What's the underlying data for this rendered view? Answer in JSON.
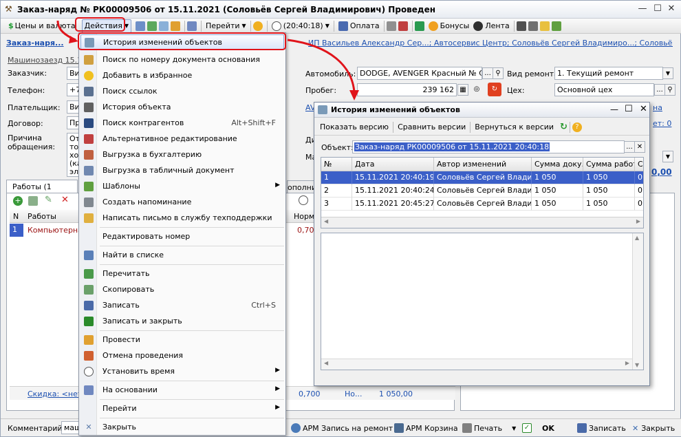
{
  "window": {
    "title": "Заказ-наряд № РК00009506 от 15.11.2021 (Соловьёв Сергей Владимирович) Проведен"
  },
  "toolbar": {
    "prices_currency": "Цены и валюта",
    "actions": "Действия",
    "go": "Перейти",
    "time": "(20:40:18)",
    "payment": "Оплата",
    "bonuses": "Бонусы",
    "tape": "Лента"
  },
  "form": {
    "tab_label": "Заказ-наря...",
    "header_link": "Машинозаезд 15.11",
    "org_link": "ИП Васильев Александр Сер...; Автосервис Центр; Соловьёв Сергей Владимиро...; Соловьёв Серге...",
    "customer_label": "Заказчик:",
    "customer_value": "Ви",
    "phone_label": "Телефон:",
    "phone_value": "+7",
    "payer_label": "Плательщик:",
    "payer_value": "Ви",
    "contract_label": "Договор:",
    "contract_value": "Пр",
    "reason_label": "Причина обращения:",
    "reason_lines": [
      "От",
      "тор",
      "хол",
      "(ка",
      "эл"
    ],
    "car_label": "Автомобиль:",
    "car_value": "DODGE, AVENGER Красный № С3",
    "mileage_label": "Пробег:",
    "mileage_value": "239 162",
    "repair_type_label": "Вид ремонта:",
    "repair_type_value": "1. Текущий ремонт",
    "shop_label": "Цех:",
    "shop_value": "Основной цех",
    "av_link": "AV",
    "di_label": "Ди",
    "ma_label": "Ма",
    "right_link_1": "на",
    "right_link_2": "ет: 0",
    "right_link_3": "0,00",
    "works_tab": "Работы (1 поз.)",
    "extra_tab": "ополнит",
    "col_n": "N",
    "col_works": "Работы",
    "col_norm": "Норм.",
    "row_n": "1",
    "row_work": "Компьютерная",
    "row_norm": "0,70",
    "discount": "Скидка: <нет>",
    "sum_norm": "0,700",
    "sum_no": "Но...",
    "sum_total": "1 050,00",
    "comment_label": "Комментарий:",
    "comment_value": "маш"
  },
  "menu": {
    "items": [
      {
        "label": "История изменений объектов"
      },
      {
        "label": "Поиск по номеру документа основания"
      },
      {
        "label": "Добавить в избранное"
      },
      {
        "label": "Поиск ссылок"
      },
      {
        "label": "История объекта"
      },
      {
        "label": "Поиск контрагентов",
        "shortcut": "Alt+Shift+F"
      },
      {
        "label": "Альтернативное редактирование"
      },
      {
        "label": "Выгрузка в бухгалтерию"
      },
      {
        "label": "Выгрузка в табличный документ"
      },
      {
        "label": "Шаблоны"
      },
      {
        "label": "Создать напоминание"
      },
      {
        "label": "Написать письмо в службу техподдержки"
      },
      {
        "label": "Редактировать номер"
      },
      {
        "label": "Найти в списке"
      },
      {
        "label": "Перечитать"
      },
      {
        "label": "Скопировать"
      },
      {
        "label": "Записать",
        "shortcut": "Ctrl+S"
      },
      {
        "label": "Записать и закрыть"
      },
      {
        "label": "Провести"
      },
      {
        "label": "Отмена проведения"
      },
      {
        "label": "Установить время"
      },
      {
        "label": "На основании"
      },
      {
        "label": "Перейти"
      },
      {
        "label": "Закрыть"
      }
    ]
  },
  "dialog": {
    "title": "История изменений объектов",
    "show_version": "Показать версию",
    "compare": "Сравнить версии",
    "revert": "Вернуться к версии",
    "object_label": "Объект:",
    "object_value": "Заказ-наряд РК00009506 от 15.11.2021 20:40:18",
    "columns": [
      "№",
      "Дата",
      "Автор изменений",
      "Сумма доку...",
      "Сумма работ",
      "С"
    ],
    "rows": [
      [
        "1",
        "15.11.2021 20:40:19",
        "Соловьёв Сергей Влади...",
        "1 050",
        "1 050",
        "0"
      ],
      [
        "2",
        "15.11.2021 20:40:24",
        "Соловьёв Сергей Влади...",
        "1 050",
        "1 050",
        "0"
      ],
      [
        "3",
        "15.11.2021 20:45:27",
        "Соловьёв Сергей Влади...",
        "1 050",
        "1 050",
        "0"
      ]
    ]
  },
  "bottom": {
    "arm_repair": "АРМ Запись на ремонт",
    "arm_cart": "АРМ Корзина",
    "print": "Печать",
    "ok": "OK",
    "save": "Записать",
    "close": "Закрыть"
  }
}
